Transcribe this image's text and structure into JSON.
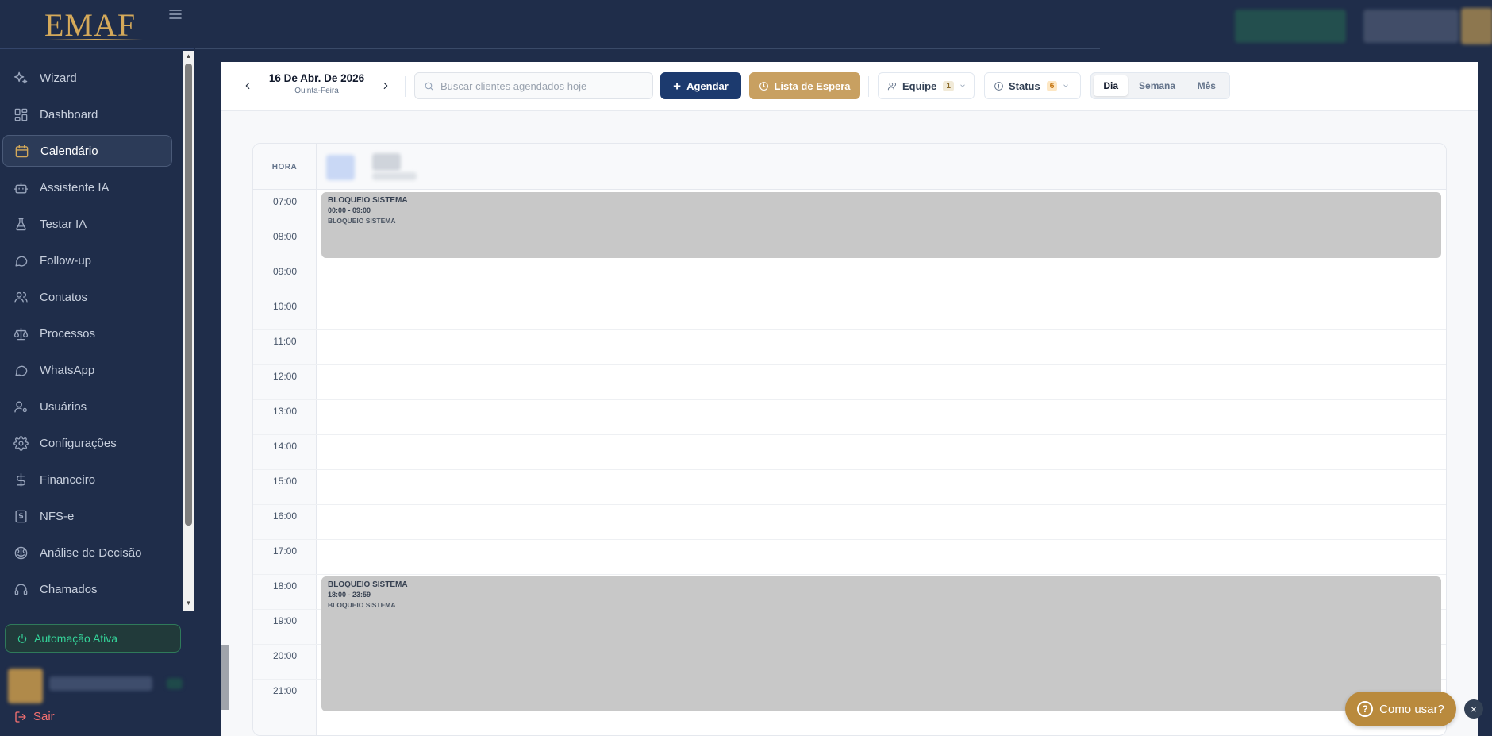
{
  "app": {
    "logo_text": "EMAF"
  },
  "sidebar": {
    "items": [
      {
        "label": "Wizard",
        "icon": "sparkle-icon"
      },
      {
        "label": "Dashboard",
        "icon": "grid-icon"
      },
      {
        "label": "Calendário",
        "icon": "calendar-icon",
        "active": true
      },
      {
        "label": "Assistente IA",
        "icon": "robot-icon"
      },
      {
        "label": "Testar IA",
        "icon": "flask-icon"
      },
      {
        "label": "Follow-up",
        "icon": "chat-icon"
      },
      {
        "label": "Contatos",
        "icon": "users-icon"
      },
      {
        "label": "Processos",
        "icon": "scale-icon"
      },
      {
        "label": "WhatsApp",
        "icon": "chat-icon"
      },
      {
        "label": "Usuários",
        "icon": "user-cog-icon"
      },
      {
        "label": "Configurações",
        "icon": "gear-icon"
      },
      {
        "label": "Financeiro",
        "icon": "dollar-icon"
      },
      {
        "label": "NFS-e",
        "icon": "receipt-icon"
      },
      {
        "label": "Análise de Decisão",
        "icon": "brain-icon"
      },
      {
        "label": "Chamados",
        "icon": "headset-icon"
      }
    ],
    "automation_label": "Automação Ativa",
    "logout_label": "Sair"
  },
  "toolbar": {
    "date_main": "16 De Abr. De 2026",
    "date_sub": "Quinta-Feira",
    "search_placeholder": "Buscar clientes agendados hoje",
    "agendar_label": "Agendar",
    "espera_label": "Lista de Espera",
    "equipe_label": "Equipe",
    "equipe_count": "1",
    "status_label": "Status",
    "status_count": "6",
    "views": [
      "Dia",
      "Semana",
      "Mês"
    ],
    "active_view": "Dia"
  },
  "calendar": {
    "hora_label": "HORA",
    "hours": [
      "07:00",
      "08:00",
      "09:00",
      "10:00",
      "11:00",
      "12:00",
      "13:00",
      "14:00",
      "15:00",
      "16:00",
      "17:00",
      "18:00",
      "19:00",
      "20:00",
      "21:00"
    ],
    "events": [
      {
        "title": "BLOQUEIO SISTEMA",
        "time": "00:00 - 09:00",
        "description": "BLOQUEIO SISTEMA"
      },
      {
        "title": "BLOQUEIO SISTEMA",
        "time": "18:00 - 23:59",
        "description": "BLOQUEIO SISTEMA"
      }
    ]
  },
  "help": {
    "label": "Como usar?",
    "close": "×"
  },
  "colors": {
    "sidebar_bg": "#1f2d4a",
    "accent_gold": "#c8a061",
    "primary_navy": "#1c3a6e",
    "event_gray": "#c8c8c8",
    "automation_green": "#34d399",
    "logout_red": "#f87171"
  }
}
